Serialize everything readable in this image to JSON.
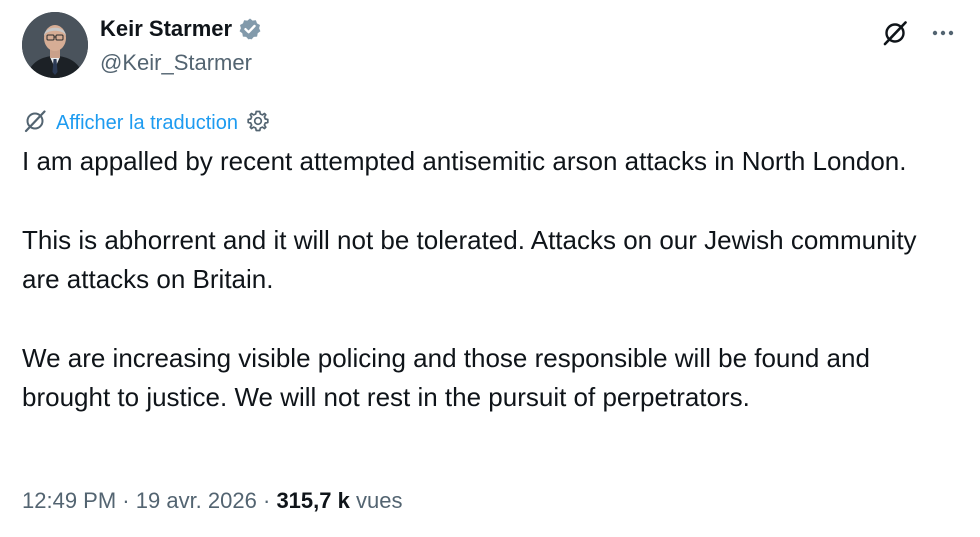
{
  "author": {
    "display_name": "Keir Starmer",
    "handle": "@Keir_Starmer"
  },
  "translate": {
    "label": "Afficher la traduction"
  },
  "tweet": {
    "paragraphs": [
      "I am appalled by recent attempted antisemitic arson attacks in North London.",
      "This is abhorrent and it will not be tolerated. Attacks on our Jewish community are attacks on Britain.",
      "We are increasing visible policing and those responsible will be found and brought to justice. We will not rest in the pursuit of perpetrators."
    ]
  },
  "meta": {
    "time": "12:49 PM",
    "separator": "·",
    "date": "19 avr. 2026",
    "views_count": "315,7 k",
    "views_label": "vues"
  },
  "icons": {
    "verified": "verified-badge-icon",
    "grok": "grok-icon",
    "more": "more-icon",
    "translate": "translate-icon",
    "settings": "gear-icon"
  },
  "colors": {
    "accent": "#1d9bf0",
    "text": "#0f1419",
    "secondary": "#536471",
    "verified_badge": "#829aab"
  }
}
